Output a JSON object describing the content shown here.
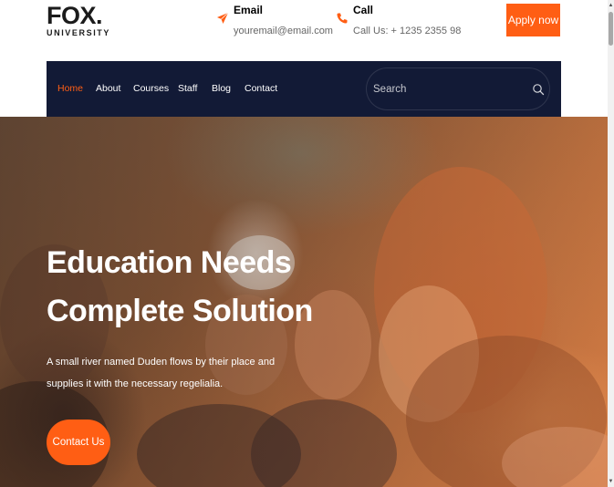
{
  "logo": {
    "main": "FOX.",
    "sub": "UNIVERSITY"
  },
  "header": {
    "email": {
      "icon": "paper-plane-icon",
      "title": "Email",
      "value": "youremail@email.com"
    },
    "call": {
      "icon": "phone-icon",
      "title": "Call",
      "value": "Call Us: + 1235 2355 98"
    },
    "apply_label": "Apply now"
  },
  "nav": {
    "items": [
      {
        "label": "Home",
        "active": true
      },
      {
        "label": "About",
        "active": false
      },
      {
        "label": "Courses",
        "active": false
      },
      {
        "label": "Staff",
        "active": false
      },
      {
        "label": "Blog",
        "active": false
      },
      {
        "label": "Contact",
        "active": false
      }
    ],
    "search": {
      "placeholder": "Search",
      "value": "",
      "icon": "search-icon"
    }
  },
  "hero": {
    "title_line1": "Education Needs",
    "title_line2": "Complete Solution",
    "text": "A small river named Duden flows by their place and supplies it with the necessary regelialia.",
    "cta_label": "Contact Us"
  },
  "colors": {
    "accent": "#ff5e14",
    "nav_background": "#121a36",
    "text_dark": "#1b1b1b"
  }
}
